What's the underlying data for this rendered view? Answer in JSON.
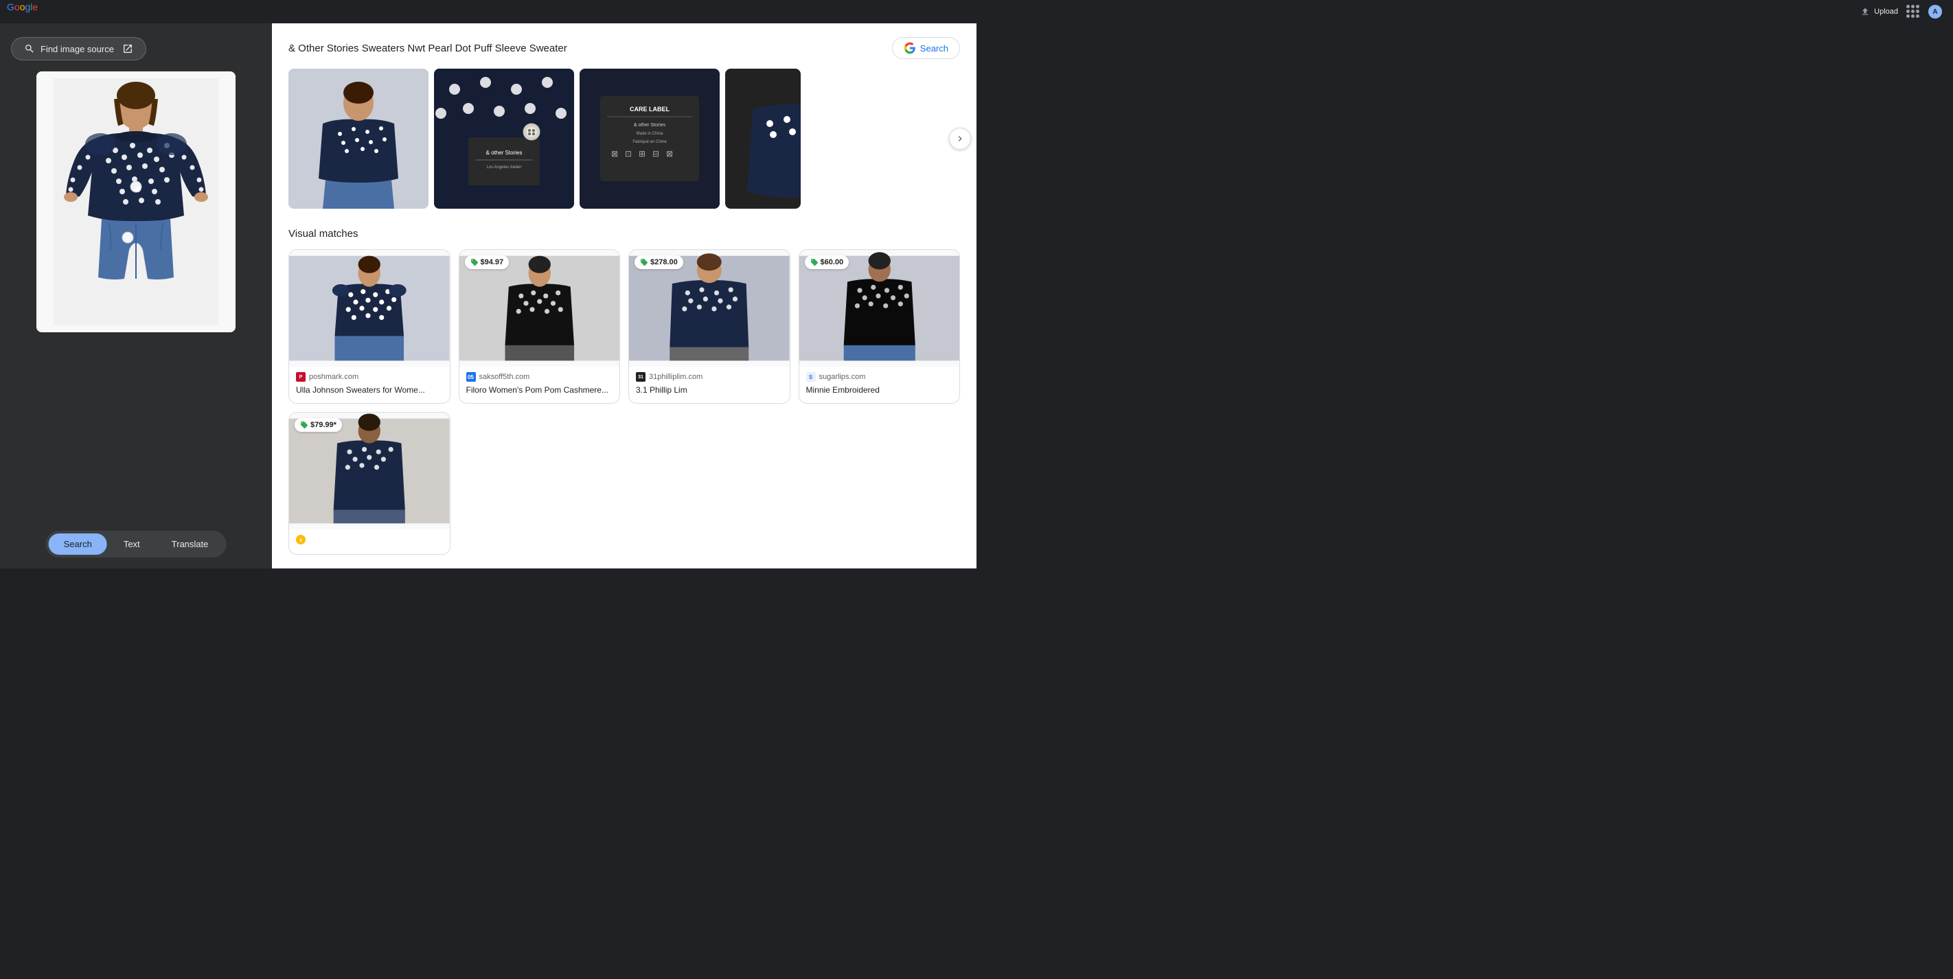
{
  "header": {
    "logo": {
      "g": "G",
      "oogle": "oogle"
    },
    "upload_label": "Upload",
    "search_label": "Search"
  },
  "left_panel": {
    "find_image_btn": "Find image source",
    "tabs": [
      {
        "id": "search",
        "label": "Search",
        "active": true
      },
      {
        "id": "text",
        "label": "Text",
        "active": false
      },
      {
        "id": "translate",
        "label": "Translate",
        "active": false
      }
    ]
  },
  "right_panel": {
    "section_title": "& Other Stories Sweaters Nwt Pearl Dot Puff Sleeve Sweater",
    "search_button_label": "Search",
    "visual_matches_title": "Visual matches",
    "matches": [
      {
        "id": 1,
        "source": "poshmark.com",
        "source_short": "P",
        "favicon_color": "poshmark",
        "title": "Ulla Johnson Sweaters for Wome...",
        "has_price": false
      },
      {
        "id": 2,
        "source": "saksoff5th.com",
        "source_short": "05",
        "favicon_color": "05",
        "title": "Filoro Women's Pom Pom Cashmere...",
        "price": "$94.97",
        "has_price": true
      },
      {
        "id": 3,
        "source": "31philliplim.com",
        "source_short": "31",
        "favicon_color": "31",
        "title": "3.1 Phillip Lim",
        "price": "$278.00",
        "has_price": true
      },
      {
        "id": 4,
        "source": "sugarlips.com",
        "source_short": "S",
        "favicon_color": "s",
        "title": "Minnie Embroidered",
        "price": "$60.00",
        "has_price": true
      }
    ],
    "bottom_matches": [
      {
        "id": 5,
        "source": "",
        "price": "$79.99*",
        "has_price": true,
        "favicon_color": "tag"
      }
    ]
  }
}
